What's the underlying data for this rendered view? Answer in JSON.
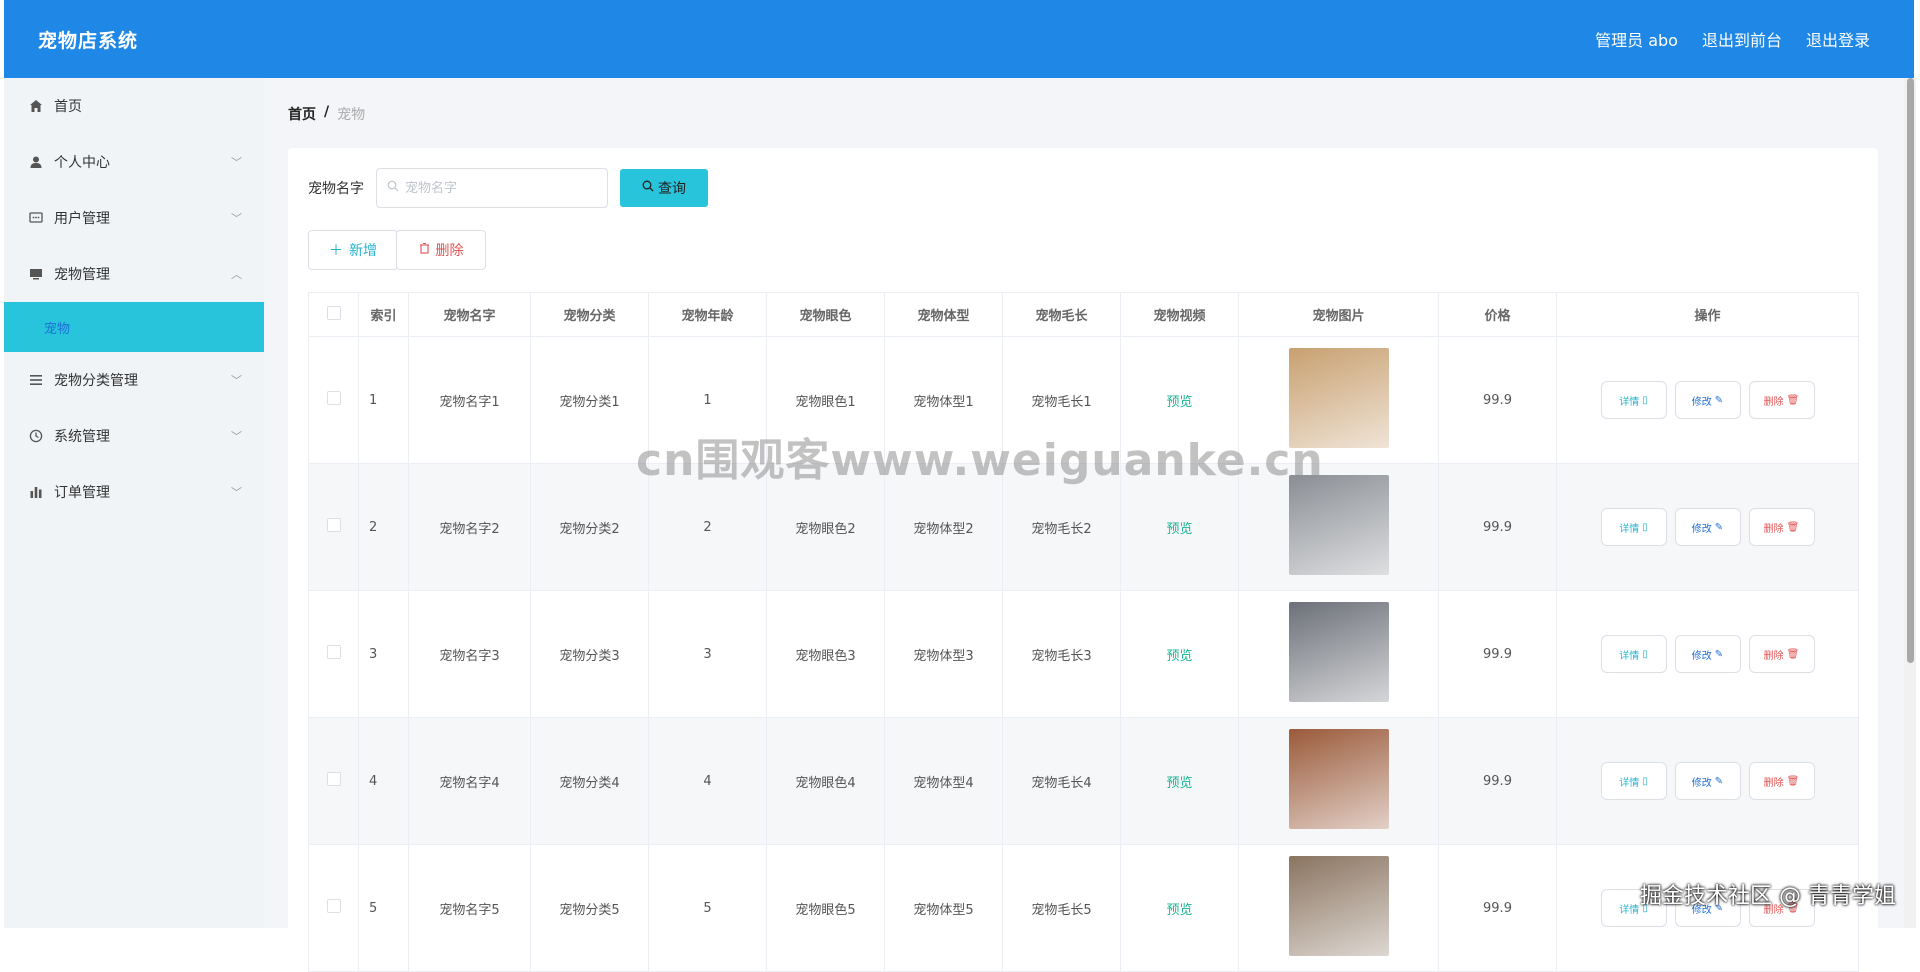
{
  "header": {
    "title": "宠物店系统",
    "admin": "管理员 abo",
    "to_front": "退出到前台",
    "logout": "退出登录"
  },
  "sidebar": {
    "items": [
      {
        "label": "首页",
        "icon": "home-icon"
      },
      {
        "label": "个人中心",
        "icon": "user-icon"
      },
      {
        "label": "用户管理",
        "icon": "chat-icon"
      },
      {
        "label": "宠物管理",
        "icon": "monitor-icon"
      },
      {
        "label": "宠物分类管理",
        "icon": "list-icon"
      },
      {
        "label": "系统管理",
        "icon": "clock-icon"
      },
      {
        "label": "订单管理",
        "icon": "bar-chart-icon"
      }
    ],
    "active_sub": "宠物"
  },
  "breadcrumb": {
    "home": "首页",
    "sep": "/",
    "current": "宠物"
  },
  "search": {
    "label": "宠物名字",
    "placeholder": "宠物名字",
    "button": "查询"
  },
  "actions": {
    "add": "新增",
    "delete": "删除"
  },
  "table": {
    "headers": [
      "索引",
      "宠物名字",
      "宠物分类",
      "宠物年龄",
      "宠物眼色",
      "宠物体型",
      "宠物毛长",
      "宠物视频",
      "宠物图片",
      "价格",
      "操作"
    ],
    "rows": [
      {
        "index": "1",
        "name": "宠物名字1",
        "category": "宠物分类1",
        "age": "1",
        "eye": "宠物眼色1",
        "body": "宠物体型1",
        "fur": "宠物毛长1",
        "video": "预览",
        "price": "99.9",
        "image": "cat-lucky-photo",
        "color": "#c8a070"
      },
      {
        "index": "2",
        "name": "宠物名字2",
        "category": "宠物分类2",
        "age": "2",
        "eye": "宠物眼色2",
        "body": "宠物体型2",
        "fur": "宠物毛长2",
        "video": "预览",
        "price": "99.9",
        "image": "gray-cat-photo",
        "color": "#8a8e94"
      },
      {
        "index": "3",
        "name": "宠物名字3",
        "category": "宠物分类3",
        "age": "3",
        "eye": "宠物眼色3",
        "body": "宠物体型3",
        "fur": "宠物毛长3",
        "video": "预览",
        "price": "99.9",
        "image": "husky-photo",
        "color": "#6c7078"
      },
      {
        "index": "4",
        "name": "宠物名字4",
        "category": "宠物分类4",
        "age": "4",
        "eye": "宠物眼色4",
        "body": "宠物体型4",
        "fur": "宠物毛长4",
        "video": "预览",
        "price": "99.9",
        "image": "poodle-photo",
        "color": "#9a5a3a"
      },
      {
        "index": "5",
        "name": "宠物名字5",
        "category": "宠物分类5",
        "age": "5",
        "eye": "宠物眼色5",
        "body": "宠物体型5",
        "fur": "宠物毛长5",
        "video": "预览",
        "price": "99.9",
        "image": "cats-photo",
        "color": "#8a7460"
      }
    ],
    "op_labels": {
      "detail": "详情",
      "edit": "修改",
      "delete": "删除"
    }
  },
  "overlay": {
    "watermark": "cn围观客www.weiguanke.cn",
    "credit": "掘金技术社区 @ 青青学姐"
  }
}
